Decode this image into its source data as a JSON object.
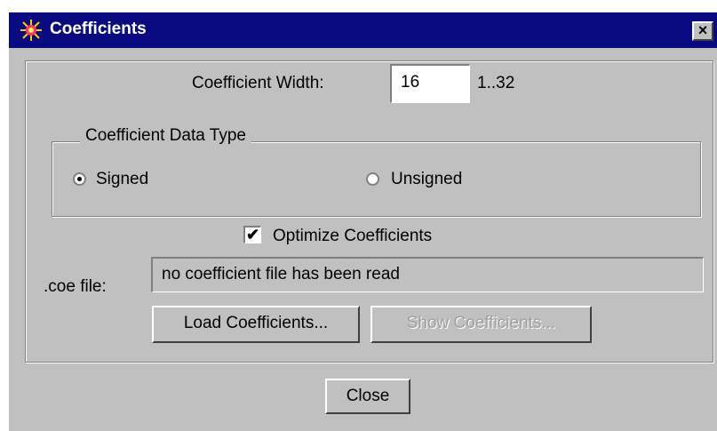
{
  "window": {
    "title": "Coefficients",
    "close_glyph": "×"
  },
  "width": {
    "label": "Coefficient Width:",
    "value": "16",
    "range": "1..32"
  },
  "data_type": {
    "group_title": "Coefficient Data Type",
    "options": [
      {
        "label": "Signed",
        "selected": true
      },
      {
        "label": "Unsigned",
        "selected": false
      }
    ]
  },
  "optimize": {
    "label": "Optimize Coefficients",
    "checked": true,
    "check_glyph": "✔"
  },
  "coe_file": {
    "label": ".coe file:",
    "value": "no coefficient file has been read"
  },
  "buttons": {
    "load": "Load Coefficients...",
    "show": "Show Coefficients...",
    "close": "Close"
  },
  "icons": {
    "app": "sunburst-icon"
  },
  "colors": {
    "titlebar": "#0a0a80",
    "face": "#c0c0c0",
    "disabled_text": "#a0a0a0"
  }
}
